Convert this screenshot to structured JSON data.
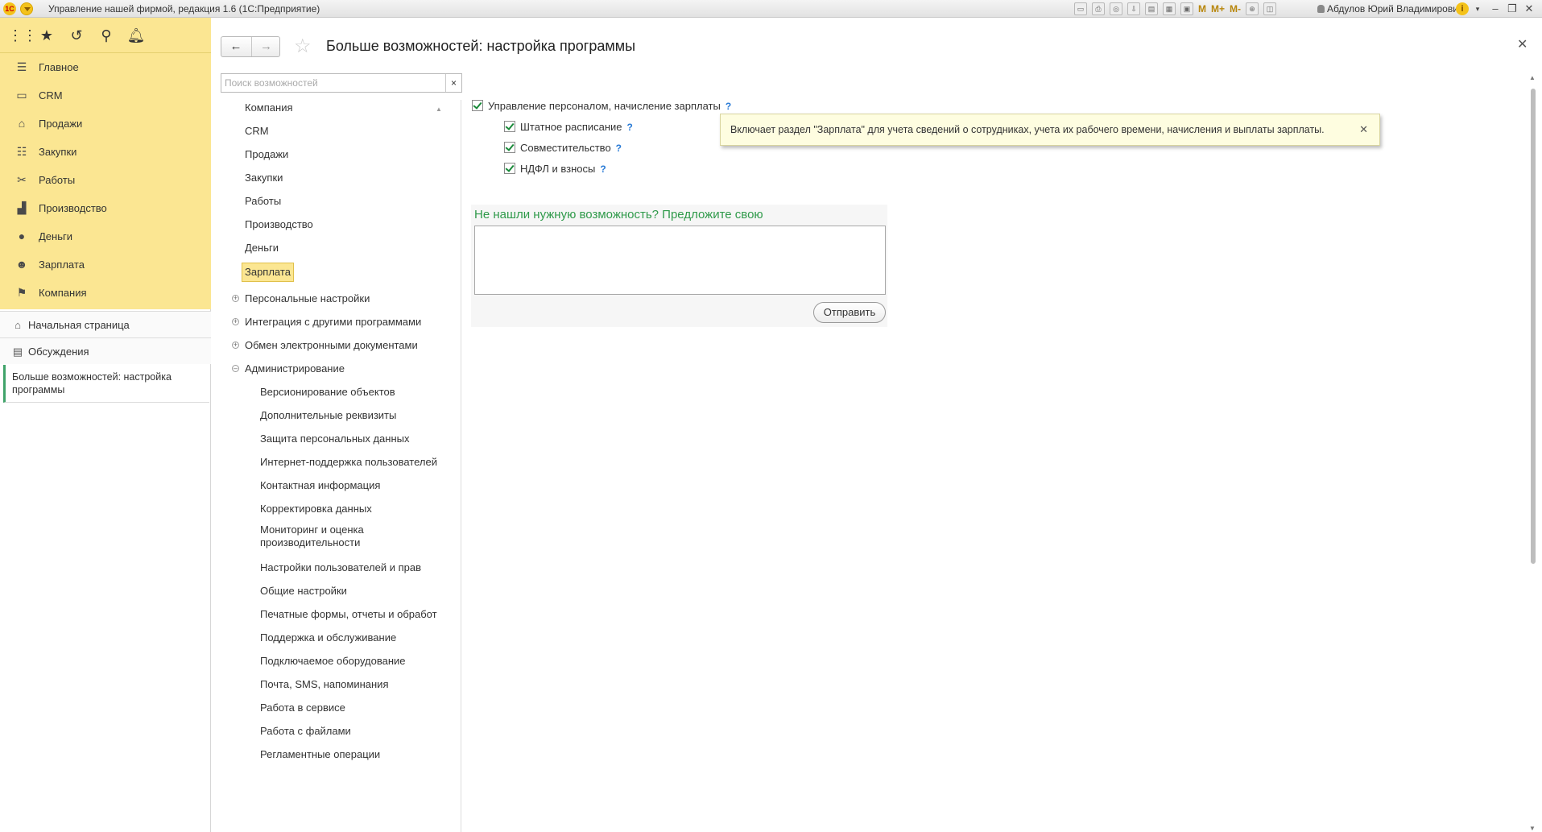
{
  "window": {
    "title": "Управление нашей фирмой, редакция 1.6  (1С:Предприятие)",
    "logo": "1С",
    "user": "Абдулов Юрий Владимирович",
    "mem_labels": [
      "M",
      "M+",
      "M-"
    ],
    "info": "i"
  },
  "sidebar": {
    "sections": [
      {
        "label": "Главное",
        "icon": "menu-icon"
      },
      {
        "label": "CRM",
        "icon": "crm-icon"
      },
      {
        "label": "Продажи",
        "icon": "cart-icon"
      },
      {
        "label": "Закупки",
        "icon": "purchase-icon"
      },
      {
        "label": "Работы",
        "icon": "tools-icon"
      },
      {
        "label": "Производство",
        "icon": "factory-icon"
      },
      {
        "label": "Деньги",
        "icon": "money-icon"
      },
      {
        "label": "Зарплата",
        "icon": "people-icon"
      },
      {
        "label": "Компания",
        "icon": "flag-icon"
      }
    ],
    "links": [
      {
        "label": "Начальная страница",
        "icon": "home-icon"
      },
      {
        "label": "Обсуждения",
        "icon": "chat-icon"
      }
    ],
    "open_form": "Больше возможностей: настройка программы"
  },
  "form": {
    "title": "Больше возможностей: настройка программы",
    "search_placeholder": "Поиск возможностей",
    "search_clear": "×",
    "tree": {
      "top_items": [
        "Компания",
        "CRM",
        "Продажи",
        "Закупки",
        "Работы",
        "Производство",
        "Деньги",
        "Зарплата"
      ],
      "selected": "Зарплата",
      "groups": [
        "Персональные настройки",
        "Интеграция с другими программами",
        "Обмен электронными документами",
        "Администрирование"
      ],
      "admin_items": [
        "Версионирование объектов",
        "Дополнительные реквизиты",
        "Защита персональных данных",
        "Интернет-поддержка пользователей",
        "Контактная информация",
        "Корректировка данных",
        "Мониторинг и оценка",
        "производительности",
        "Настройки пользователей и прав",
        "Общие настройки",
        "Печатные формы, отчеты и обработ",
        "Поддержка и обслуживание",
        "Подключаемое оборудование",
        "Почта, SMS, напоминания",
        "Работа в сервисе",
        "Работа с файлами",
        "Регламентные операции"
      ]
    },
    "options": {
      "main": "Управление персоналом, начисление зарплаты",
      "sub": [
        "Штатное расписание",
        "Совместительство",
        "НДФЛ и взносы"
      ],
      "help": "?"
    },
    "tooltip": "Включает раздел \"Зарплата\" для учета сведений о сотрудниках, учета их рабочего времени, начисления и выплаты зарплаты.",
    "suggest": {
      "title": "Не нашли нужную возможность? Предложите свою",
      "send": "Отправить"
    }
  }
}
